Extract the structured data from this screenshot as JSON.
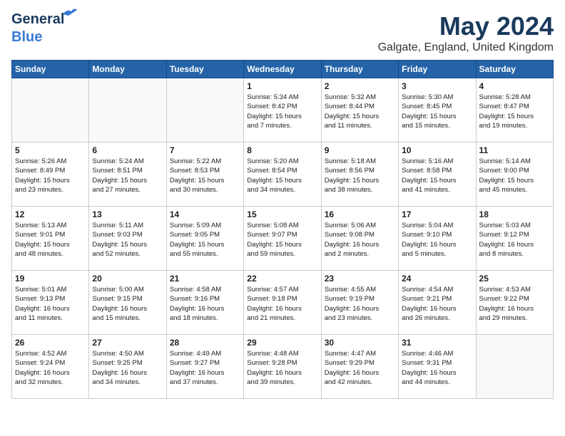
{
  "header": {
    "logo_line1": "General",
    "logo_line2": "Blue",
    "month": "May 2024",
    "location": "Galgate, England, United Kingdom"
  },
  "days_of_week": [
    "Sunday",
    "Monday",
    "Tuesday",
    "Wednesday",
    "Thursday",
    "Friday",
    "Saturday"
  ],
  "weeks": [
    [
      {
        "day": "",
        "info": ""
      },
      {
        "day": "",
        "info": ""
      },
      {
        "day": "",
        "info": ""
      },
      {
        "day": "1",
        "info": "Sunrise: 5:34 AM\nSunset: 8:42 PM\nDaylight: 15 hours\nand 7 minutes."
      },
      {
        "day": "2",
        "info": "Sunrise: 5:32 AM\nSunset: 8:44 PM\nDaylight: 15 hours\nand 11 minutes."
      },
      {
        "day": "3",
        "info": "Sunrise: 5:30 AM\nSunset: 8:45 PM\nDaylight: 15 hours\nand 15 minutes."
      },
      {
        "day": "4",
        "info": "Sunrise: 5:28 AM\nSunset: 8:47 PM\nDaylight: 15 hours\nand 19 minutes."
      }
    ],
    [
      {
        "day": "5",
        "info": "Sunrise: 5:26 AM\nSunset: 8:49 PM\nDaylight: 15 hours\nand 23 minutes."
      },
      {
        "day": "6",
        "info": "Sunrise: 5:24 AM\nSunset: 8:51 PM\nDaylight: 15 hours\nand 27 minutes."
      },
      {
        "day": "7",
        "info": "Sunrise: 5:22 AM\nSunset: 8:53 PM\nDaylight: 15 hours\nand 30 minutes."
      },
      {
        "day": "8",
        "info": "Sunrise: 5:20 AM\nSunset: 8:54 PM\nDaylight: 15 hours\nand 34 minutes."
      },
      {
        "day": "9",
        "info": "Sunrise: 5:18 AM\nSunset: 8:56 PM\nDaylight: 15 hours\nand 38 minutes."
      },
      {
        "day": "10",
        "info": "Sunrise: 5:16 AM\nSunset: 8:58 PM\nDaylight: 15 hours\nand 41 minutes."
      },
      {
        "day": "11",
        "info": "Sunrise: 5:14 AM\nSunset: 9:00 PM\nDaylight: 15 hours\nand 45 minutes."
      }
    ],
    [
      {
        "day": "12",
        "info": "Sunrise: 5:13 AM\nSunset: 9:01 PM\nDaylight: 15 hours\nand 48 minutes."
      },
      {
        "day": "13",
        "info": "Sunrise: 5:11 AM\nSunset: 9:03 PM\nDaylight: 15 hours\nand 52 minutes."
      },
      {
        "day": "14",
        "info": "Sunrise: 5:09 AM\nSunset: 9:05 PM\nDaylight: 15 hours\nand 55 minutes."
      },
      {
        "day": "15",
        "info": "Sunrise: 5:08 AM\nSunset: 9:07 PM\nDaylight: 15 hours\nand 59 minutes."
      },
      {
        "day": "16",
        "info": "Sunrise: 5:06 AM\nSunset: 9:08 PM\nDaylight: 16 hours\nand 2 minutes."
      },
      {
        "day": "17",
        "info": "Sunrise: 5:04 AM\nSunset: 9:10 PM\nDaylight: 16 hours\nand 5 minutes."
      },
      {
        "day": "18",
        "info": "Sunrise: 5:03 AM\nSunset: 9:12 PM\nDaylight: 16 hours\nand 8 minutes."
      }
    ],
    [
      {
        "day": "19",
        "info": "Sunrise: 5:01 AM\nSunset: 9:13 PM\nDaylight: 16 hours\nand 11 minutes."
      },
      {
        "day": "20",
        "info": "Sunrise: 5:00 AM\nSunset: 9:15 PM\nDaylight: 16 hours\nand 15 minutes."
      },
      {
        "day": "21",
        "info": "Sunrise: 4:58 AM\nSunset: 9:16 PM\nDaylight: 16 hours\nand 18 minutes."
      },
      {
        "day": "22",
        "info": "Sunrise: 4:57 AM\nSunset: 9:18 PM\nDaylight: 16 hours\nand 21 minutes."
      },
      {
        "day": "23",
        "info": "Sunrise: 4:55 AM\nSunset: 9:19 PM\nDaylight: 16 hours\nand 23 minutes."
      },
      {
        "day": "24",
        "info": "Sunrise: 4:54 AM\nSunset: 9:21 PM\nDaylight: 16 hours\nand 26 minutes."
      },
      {
        "day": "25",
        "info": "Sunrise: 4:53 AM\nSunset: 9:22 PM\nDaylight: 16 hours\nand 29 minutes."
      }
    ],
    [
      {
        "day": "26",
        "info": "Sunrise: 4:52 AM\nSunset: 9:24 PM\nDaylight: 16 hours\nand 32 minutes."
      },
      {
        "day": "27",
        "info": "Sunrise: 4:50 AM\nSunset: 9:25 PM\nDaylight: 16 hours\nand 34 minutes."
      },
      {
        "day": "28",
        "info": "Sunrise: 4:49 AM\nSunset: 9:27 PM\nDaylight: 16 hours\nand 37 minutes."
      },
      {
        "day": "29",
        "info": "Sunrise: 4:48 AM\nSunset: 9:28 PM\nDaylight: 16 hours\nand 39 minutes."
      },
      {
        "day": "30",
        "info": "Sunrise: 4:47 AM\nSunset: 9:29 PM\nDaylight: 16 hours\nand 42 minutes."
      },
      {
        "day": "31",
        "info": "Sunrise: 4:46 AM\nSunset: 9:31 PM\nDaylight: 16 hours\nand 44 minutes."
      },
      {
        "day": "",
        "info": ""
      }
    ]
  ]
}
